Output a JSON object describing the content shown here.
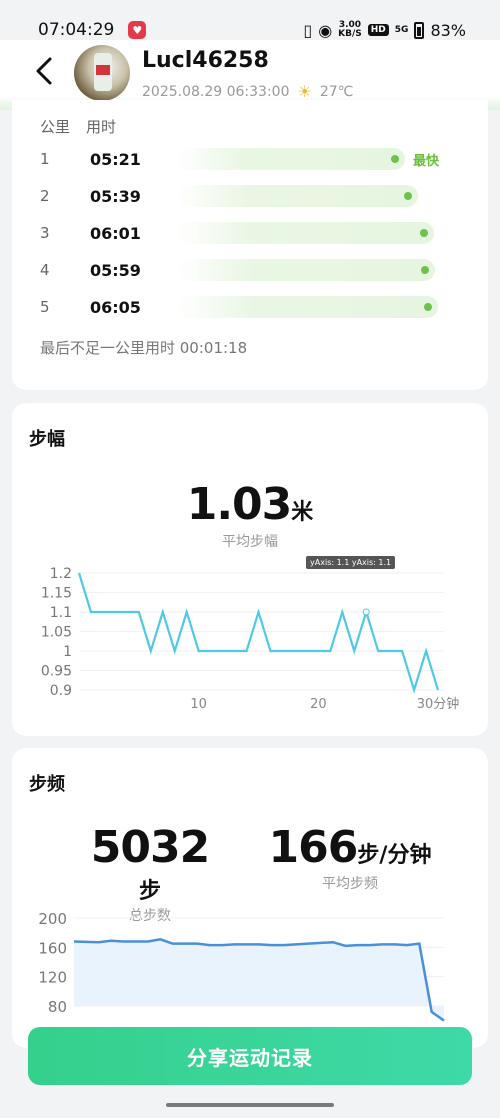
{
  "status": {
    "time": "07:04:29",
    "net_speed": "3.00",
    "net_unit": "KB/S",
    "hd": "HD",
    "net_type": "5G",
    "battery": "83%"
  },
  "header": {
    "username": "Lucl46258",
    "datetime": "2025.08.29 06:33:00",
    "weather": "27℃"
  },
  "km_splits": {
    "col_km": "公里",
    "col_time": "用时",
    "rows": [
      {
        "km": "1",
        "time": "05:21",
        "badge": "最快"
      },
      {
        "km": "2",
        "time": "05:39",
        "badge": ""
      },
      {
        "km": "3",
        "time": "06:01",
        "badge": ""
      },
      {
        "km": "4",
        "time": "05:59",
        "badge": ""
      },
      {
        "km": "5",
        "time": "06:05",
        "badge": ""
      }
    ],
    "footer": "最后不足一公里用时 00:01:18"
  },
  "stride": {
    "title": "步幅",
    "value": "1.03",
    "unit": "米",
    "sub": "平均步幅",
    "tooltip": "yAxis: 1.1   yAxis: 1.1"
  },
  "cadence": {
    "title": "步频",
    "steps_value": "5032",
    "steps_unit": "步",
    "steps_sub": "总步数",
    "avg_value": "166",
    "avg_unit": "步/分钟",
    "avg_sub": "平均步频"
  },
  "share_label": "分享运动记录",
  "chart_data": [
    {
      "type": "line",
      "ylim": [
        0.9,
        1.2
      ],
      "y_ticks": [
        "1.2",
        "1.15",
        "1.1",
        "1.05",
        "1",
        "0.95",
        "0.9"
      ],
      "x_ticks": [
        "10",
        "20",
        "30分钟"
      ],
      "x_tick_values": [
        10,
        20,
        30
      ],
      "xlim": [
        0,
        30.5
      ],
      "series": [
        {
          "x": [
            0,
            1,
            2,
            3,
            4,
            5,
            6,
            7,
            8,
            9,
            10,
            11,
            12,
            13,
            14,
            15,
            16,
            17,
            18,
            19,
            20,
            21,
            22,
            23,
            24,
            25,
            26,
            27,
            28,
            29,
            30
          ],
          "values": [
            1.2,
            1.1,
            1.1,
            1.1,
            1.1,
            1.1,
            1.0,
            1.1,
            1.0,
            1.1,
            1.0,
            1.0,
            1.0,
            1.0,
            1.0,
            1.1,
            1.0,
            1.0,
            1.0,
            1.0,
            1.0,
            1.0,
            1.1,
            1.0,
            1.1,
            1.0,
            1.0,
            1.0,
            0.9,
            1.0,
            0.9
          ]
        }
      ]
    },
    {
      "type": "area",
      "ylim": [
        80,
        200
      ],
      "y_ticks": [
        "200",
        "160",
        "120",
        "80"
      ],
      "y_tick_values": [
        200,
        160,
        120,
        80
      ],
      "xlim": [
        0,
        30
      ],
      "series": [
        {
          "x": [
            0,
            2,
            3,
            4,
            5,
            6,
            7,
            8,
            9,
            10,
            11,
            12,
            13,
            14,
            15,
            16,
            17,
            18,
            19,
            20,
            21,
            22,
            23,
            24,
            25,
            26,
            27,
            28,
            29,
            30
          ],
          "values": [
            168,
            167,
            169,
            168,
            168,
            168,
            171,
            165,
            165,
            165,
            163,
            163,
            164,
            164,
            164,
            163,
            163,
            164,
            165,
            166,
            167,
            162,
            163,
            163,
            164,
            164,
            163,
            165,
            72,
            60
          ]
        }
      ]
    }
  ]
}
